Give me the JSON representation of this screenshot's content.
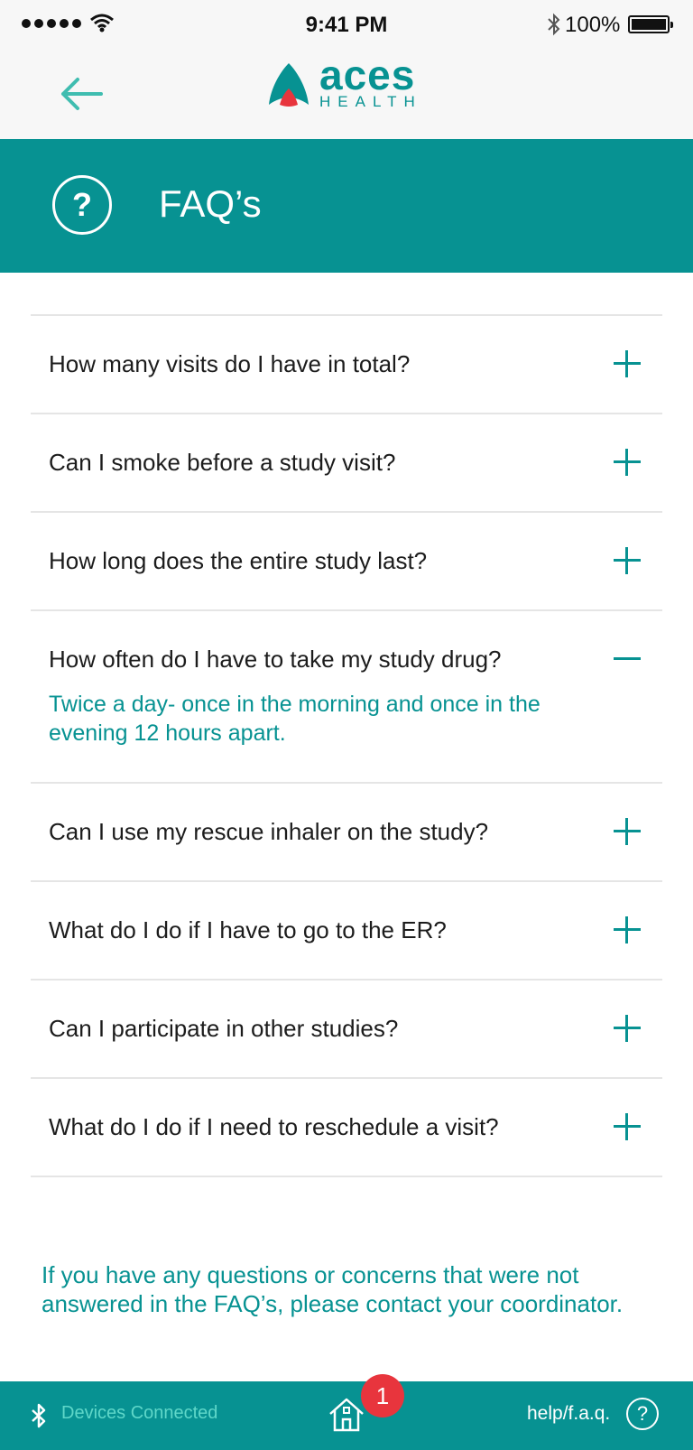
{
  "status_bar": {
    "time": "9:41 PM",
    "battery": "100%"
  },
  "nav": {
    "logo_word": "aces",
    "logo_sub": "HEALTH"
  },
  "header": {
    "title": "FAQ’s",
    "icon": "?"
  },
  "faqs": [
    {
      "question": "How many visits do I have in total?",
      "expanded": false,
      "answer": ""
    },
    {
      "question": "Can I smoke before a study visit?",
      "expanded": false,
      "answer": ""
    },
    {
      "question": "How long does the entire study last?",
      "expanded": false,
      "answer": ""
    },
    {
      "question": "How often do I have to take my study drug?",
      "expanded": true,
      "answer": "Twice a day- once in the morning and once in the evening 12 hours apart."
    },
    {
      "question": "Can I use my rescue inhaler on the study?",
      "expanded": false,
      "answer": ""
    },
    {
      "question": "What do I do if I have to go to the ER?",
      "expanded": false,
      "answer": ""
    },
    {
      "question": "Can I participate in other studies?",
      "expanded": false,
      "answer": ""
    },
    {
      "question": "What do I do if I need to reschedule a visit?",
      "expanded": false,
      "answer": ""
    }
  ],
  "footer_note": "If you have any questions or concerns that were not answered in the FAQ’s, please contact your coordinator.",
  "bottom_bar": {
    "devices_label": "Devices Connected",
    "badge_count": "1",
    "help_label": "help/f.a.q.",
    "help_icon": "?"
  },
  "colors": {
    "teal": "#079292",
    "badge_red": "#e8353d",
    "devices_green": "#5fd7c9"
  }
}
